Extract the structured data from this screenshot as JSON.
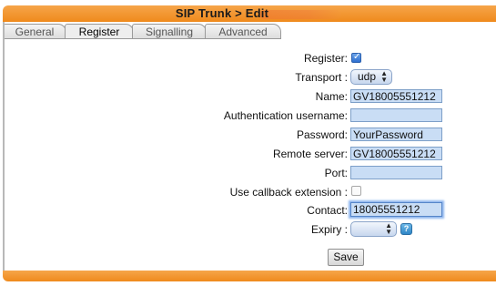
{
  "header": {
    "title": "SIP Trunk > Edit"
  },
  "tabs": [
    {
      "label": "General",
      "active": false
    },
    {
      "label": "Register",
      "active": true
    },
    {
      "label": "Signalling",
      "active": false
    },
    {
      "label": "Advanced",
      "active": false
    }
  ],
  "form": {
    "register": {
      "label": "Register:",
      "checked": true
    },
    "transport": {
      "label": "Transport :",
      "value": "udp"
    },
    "name": {
      "label": "Name:",
      "value": "GV18005551212"
    },
    "auth_username": {
      "label": "Authentication username:",
      "value": ""
    },
    "password": {
      "label": "Password:",
      "value": "YourPassword"
    },
    "remote_server": {
      "label": "Remote server:",
      "value": "GV18005551212"
    },
    "port": {
      "label": "Port:",
      "value": ""
    },
    "callback_extension": {
      "label": "Use callback extension :",
      "checked": false
    },
    "contact": {
      "label": "Contact:",
      "value": "18005551212"
    },
    "expiry": {
      "label": "Expiry :",
      "value": ""
    }
  },
  "actions": {
    "save_label": "Save"
  },
  "icons": {
    "select_arrows": "up-down-arrows-icon",
    "help": "help-icon",
    "check": "checkmark-icon"
  },
  "colors": {
    "header": "#ef8a1c",
    "field_bg": "#c9ddf5",
    "accent": "#2d6fd0"
  }
}
